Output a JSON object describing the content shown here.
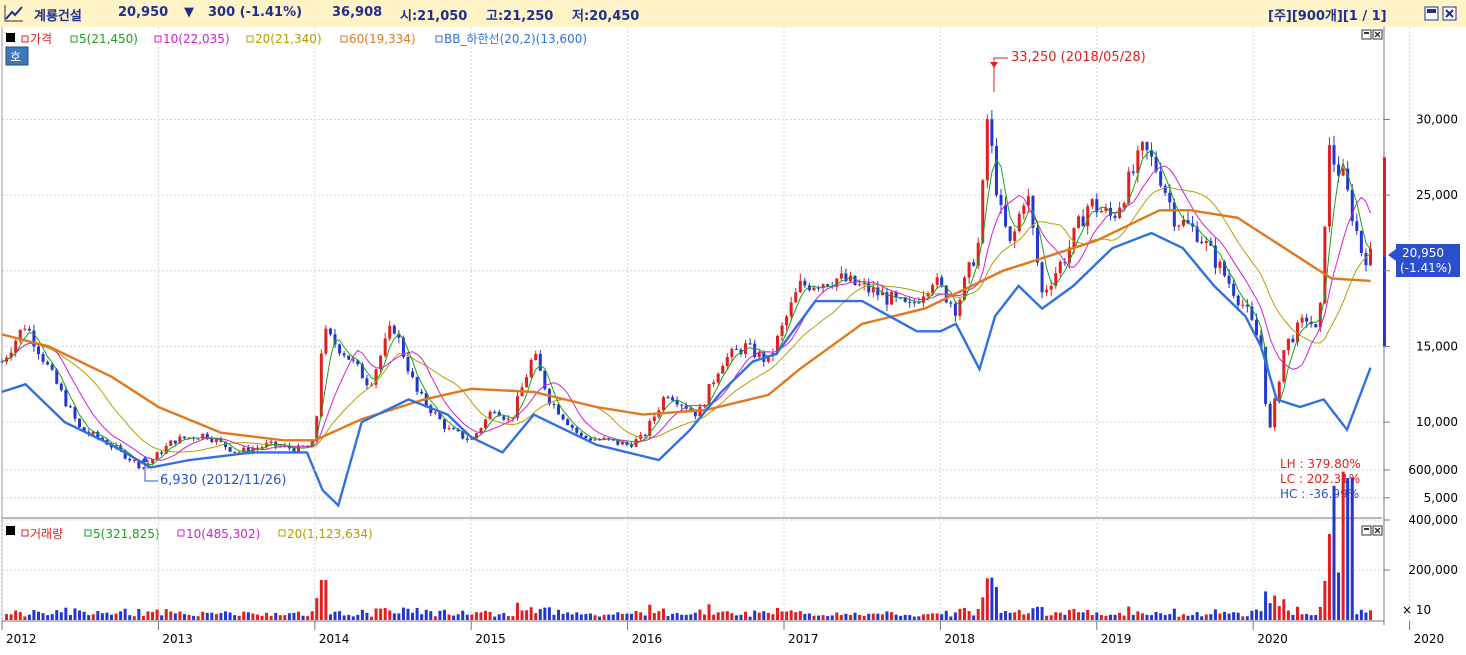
{
  "header": {
    "stock_name": "계룡건설",
    "price": "20,950",
    "change_arrow": "▼",
    "change": "300 (-1.41%)",
    "volume": "36,908",
    "open": "시:21,050",
    "high": "고:21,250",
    "low": "저:20,450",
    "right_controls": "[주][900개][1 / 1]"
  },
  "price_panel": {
    "badge": "호",
    "legend": [
      {
        "text": "가격",
        "color": "#e02020"
      },
      {
        "text": "5(21,450)",
        "color": "#1aa01a"
      },
      {
        "text": "10(22,035)",
        "color": "#d020d0"
      },
      {
        "text": "20(21,340)",
        "color": "#b0a000"
      },
      {
        "text": "60(19,334)",
        "color": "#e0781c"
      },
      {
        "text": "BB_하한선(20,2)(13,600)",
        "color": "#3070e0"
      }
    ],
    "annot_high": "33,250 (2018/05/28)",
    "annot_low": "6,930 (2012/11/26)",
    "current_price": "20,950",
    "current_change": "(-1.41%)",
    "stats": [
      {
        "text": "LH : 379.80%",
        "color": "#e02020"
      },
      {
        "text": "LC : 202.31%",
        "color": "#e02020"
      },
      {
        "text": "HC : -36.99%",
        "color": "#3050d0"
      }
    ],
    "y_ticks": [
      "30,000",
      "25,000",
      "20,000",
      "15,000",
      "10,000",
      "5,000"
    ]
  },
  "volume_panel": {
    "legend": [
      {
        "text": "거래량",
        "color": "#e02020"
      },
      {
        "text": "5(321,825)",
        "color": "#1aa01a"
      },
      {
        "text": "10(485,302)",
        "color": "#d020d0"
      },
      {
        "text": "20(1,123,634)",
        "color": "#b0a000"
      }
    ],
    "y_ticks": [
      "600,000",
      "400,000",
      "200,000"
    ],
    "multiplier": "× 10"
  },
  "chart_data": {
    "type": "line",
    "title": "계룡건설",
    "x_axis": [
      "2012",
      "2013",
      "2014",
      "2015",
      "2016",
      "2017",
      "2018",
      "2019",
      "2020",
      "2020"
    ],
    "ylim": [
      3000,
      35500
    ],
    "volume_ylim": [
      0,
      700000
    ],
    "series": [
      {
        "name": "가격",
        "x": [
          2012.0,
          2012.15,
          2012.35,
          2012.5,
          2012.65,
          2012.9,
          2013.1,
          2013.3,
          2013.5,
          2013.7,
          2013.9,
          2014.0,
          2014.05,
          2014.2,
          2014.35,
          2014.5,
          2014.65,
          2014.85,
          2015.0,
          2015.15,
          2015.25,
          2015.4,
          2015.5,
          2015.7,
          2015.85,
          2016.0,
          2016.1,
          2016.25,
          2016.45,
          2016.6,
          2016.75,
          2016.9,
          2017.1,
          2017.35,
          2017.6,
          2017.8,
          2017.95,
          2018.1,
          2018.25,
          2018.3,
          2018.38,
          2018.45,
          2018.55,
          2018.65,
          2018.8,
          2018.95,
          2019.1,
          2019.3,
          2019.4,
          2019.5,
          2019.65,
          2019.8,
          2019.95,
          2020.05,
          2020.1,
          2020.2,
          2020.35,
          2020.42,
          2020.48,
          2020.58,
          2020.7,
          2020.75
        ],
        "y": [
          14000,
          16500,
          12500,
          9500,
          8800,
          7000,
          8800,
          9200,
          8000,
          8500,
          8200,
          8600,
          16000,
          14500,
          12500,
          16500,
          12000,
          9500,
          8800,
          11000,
          10000,
          14500,
          11500,
          9000,
          8800,
          8500,
          9000,
          12000,
          10500,
          14000,
          15000,
          14000,
          19000,
          19500,
          18500,
          17500,
          19500,
          17500,
          22000,
          30000,
          24000,
          21500,
          25500,
          18500,
          21000,
          24500,
          23500,
          28000,
          26500,
          23500,
          22500,
          20000,
          17500,
          15000,
          9000,
          15000,
          17000,
          15500,
          28000,
          26000,
          21000,
          20950
        ]
      },
      {
        "name": "60(19,334)",
        "x": [
          2012.0,
          2012.3,
          2012.7,
          2013.0,
          2013.4,
          2013.8,
          2014.0,
          2014.3,
          2014.7,
          2015.0,
          2015.4,
          2015.8,
          2016.1,
          2016.5,
          2016.9,
          2017.1,
          2017.5,
          2017.9,
          2018.1,
          2018.4,
          2018.7,
          2019.0,
          2019.2,
          2019.4,
          2019.6,
          2019.9,
          2020.2,
          2020.5,
          2020.75
        ],
        "y": [
          15800,
          15000,
          13000,
          11000,
          9300,
          8800,
          8800,
          10200,
          11500,
          12200,
          12000,
          11000,
          10500,
          10800,
          11800,
          13500,
          16500,
          17500,
          18500,
          20000,
          21000,
          22000,
          23000,
          24000,
          24000,
          23500,
          21500,
          19500,
          19334
        ]
      },
      {
        "name": "BB_하한선(20,2)(13,600)",
        "x": [
          2012.0,
          2012.15,
          2012.4,
          2012.7,
          2012.95,
          2013.2,
          2013.6,
          2013.95,
          2014.05,
          2014.15,
          2014.3,
          2014.6,
          2014.85,
          2015.0,
          2015.2,
          2015.4,
          2015.6,
          2015.8,
          2016.0,
          2016.2,
          2016.4,
          2016.6,
          2016.8,
          2016.95,
          2017.2,
          2017.5,
          2017.85,
          2018.0,
          2018.1,
          2018.25,
          2018.35,
          2018.5,
          2018.65,
          2018.85,
          2019.1,
          2019.35,
          2019.55,
          2019.75,
          2019.95,
          2020.05,
          2020.15,
          2020.3,
          2020.45,
          2020.6,
          2020.75
        ],
        "y": [
          12000,
          12500,
          10000,
          8500,
          7000,
          7500,
          8000,
          8000,
          5500,
          4500,
          10000,
          11500,
          10500,
          9000,
          8000,
          10500,
          9500,
          8500,
          8000,
          7500,
          9500,
          12000,
          14000,
          14500,
          18000,
          18000,
          16000,
          16000,
          16500,
          13500,
          17000,
          19000,
          17500,
          19000,
          21500,
          22500,
          21500,
          19000,
          17000,
          15000,
          11500,
          11000,
          11500,
          9500,
          13600
        ]
      }
    ]
  }
}
